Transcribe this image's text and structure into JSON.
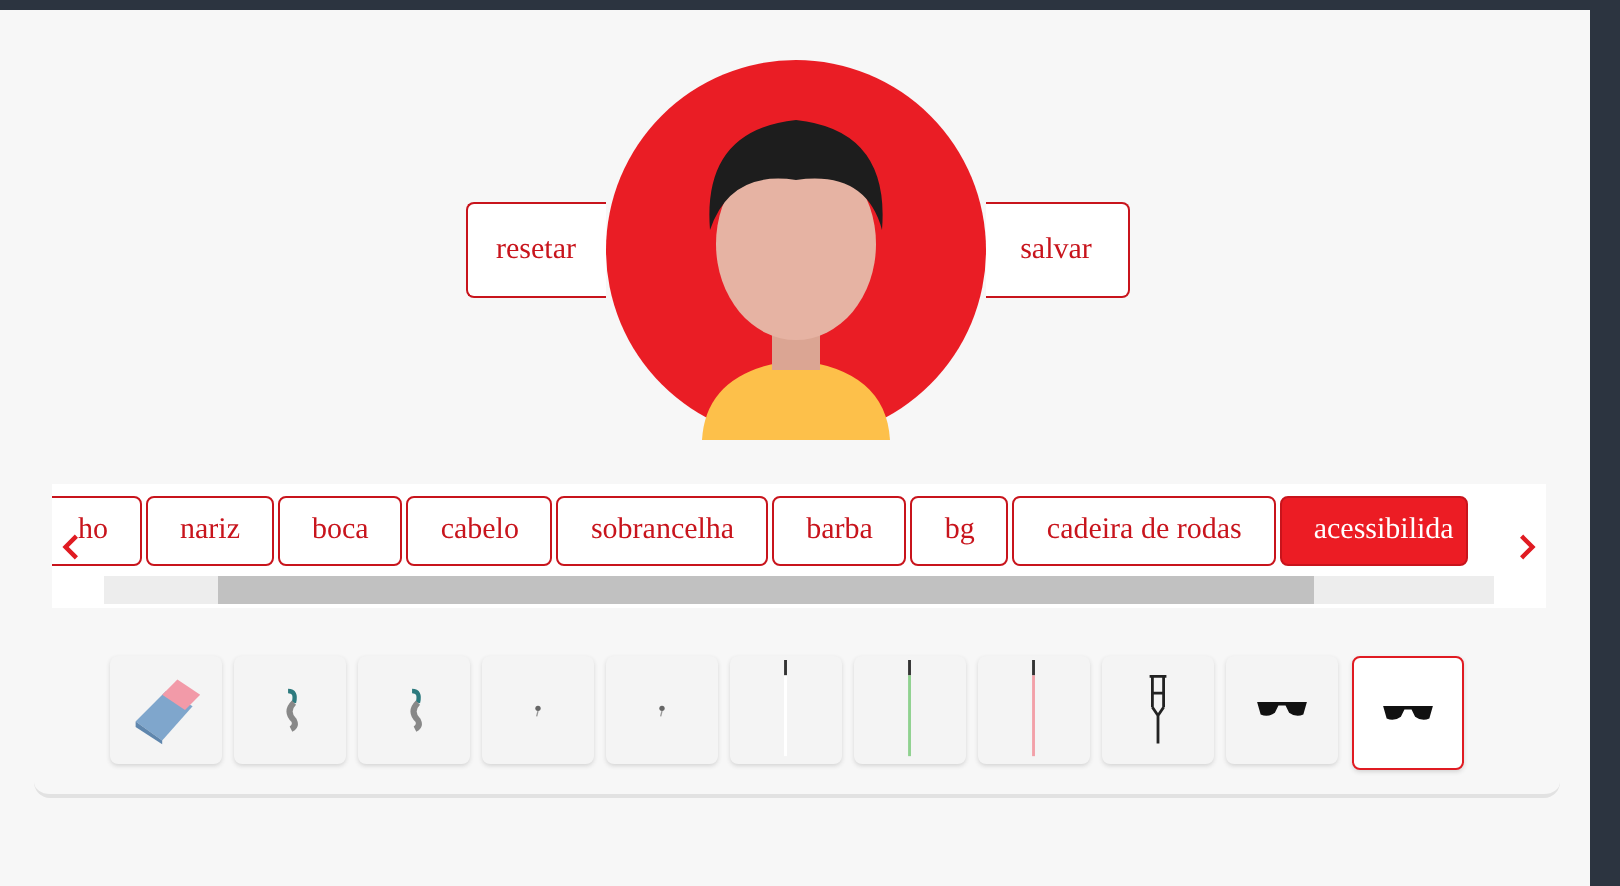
{
  "actions": [
    {
      "label": "resetar"
    },
    {
      "label": "salvar"
    }
  ],
  "categories": [
    {
      "label": "ho",
      "selected": false
    },
    {
      "label": "nariz",
      "selected": false
    },
    {
      "label": "boca",
      "selected": false
    },
    {
      "label": "cabelo",
      "selected": false
    },
    {
      "label": "sobrancelha",
      "selected": false
    },
    {
      "label": "barba",
      "selected": false
    },
    {
      "label": "bg",
      "selected": false
    },
    {
      "label": "cadeira de rodas",
      "selected": false
    },
    {
      "label": "acessibilida",
      "selected": true
    }
  ],
  "items": [
    {
      "kind": "eraser",
      "selected": false
    },
    {
      "kind": "hearing-aid",
      "selected": false
    },
    {
      "kind": "hearing-aid",
      "selected": false
    },
    {
      "kind": "earbud",
      "selected": false
    },
    {
      "kind": "earbud",
      "selected": false
    },
    {
      "kind": "cane",
      "color": "#ffffff",
      "selected": false
    },
    {
      "kind": "cane",
      "color": "#8fd18f",
      "selected": false
    },
    {
      "kind": "cane",
      "color": "#f2a0a8",
      "selected": false
    },
    {
      "kind": "crutch",
      "selected": false
    },
    {
      "kind": "sunglasses",
      "selected": false
    },
    {
      "kind": "sunglasses",
      "selected": true
    }
  ]
}
